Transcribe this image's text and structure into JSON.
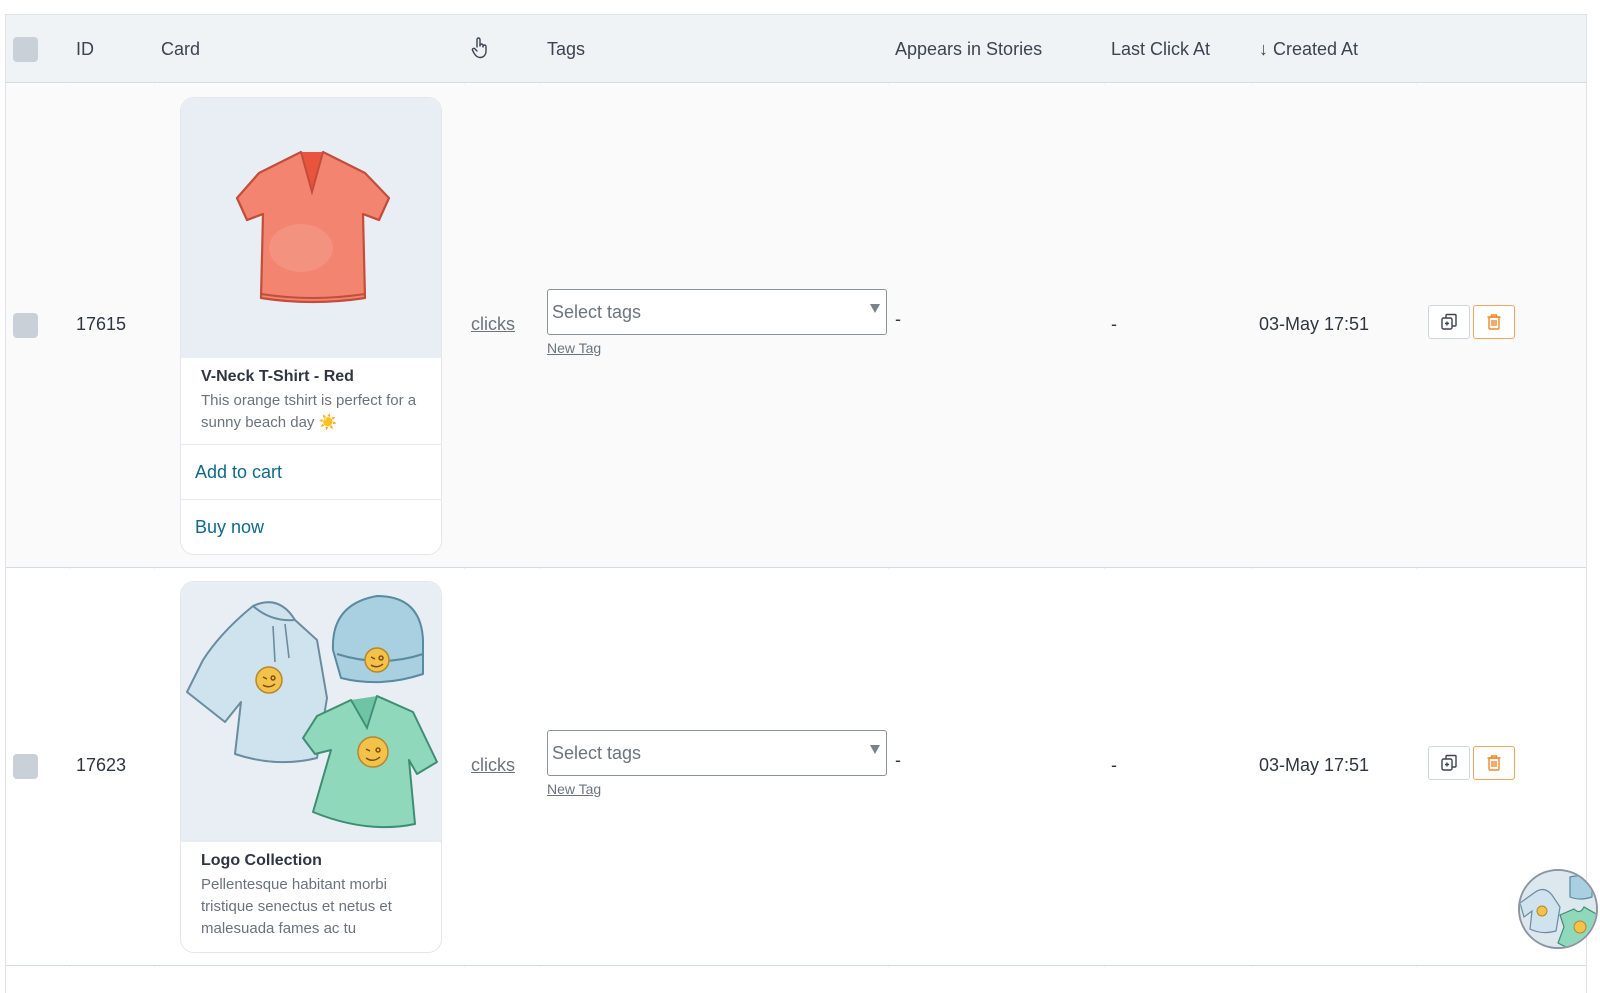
{
  "header": {
    "id": "ID",
    "card": "Card",
    "clicks_icon": "pointer-hand-icon",
    "tags": "Tags",
    "appears_in_stories": "Appears in Stories",
    "last_click_at": "Last Click At",
    "created_at": "↓ Created At"
  },
  "rows": [
    {
      "id": "17615",
      "card": {
        "title": "V-Neck T-Shirt - Red",
        "description": "This orange tshirt is perfect for a sunny beach day ☀️",
        "image": "red-tshirt-illustration",
        "buttons": [
          "Add to cart",
          "Buy now"
        ]
      },
      "clicks": "clicks",
      "tags_placeholder": "Select tags",
      "new_tag": "New Tag",
      "appears_in_stories": "-",
      "last_click_at": "-",
      "created_at": "03-May 17:51"
    },
    {
      "id": "17623",
      "card": {
        "title": "Logo Collection",
        "description": "Pellentesque habitant morbi tristique senectus et netus et malesuada fames ac tu",
        "image": "logo-collection-illustration"
      },
      "clicks": "clicks",
      "tags_placeholder": "Select tags",
      "new_tag": "New Tag",
      "appears_in_stories": "-",
      "last_click_at": "-",
      "created_at": "03-May 17:51"
    }
  ],
  "actions": {
    "duplicate_icon": "duplicate-icon",
    "delete_icon": "trash-icon"
  },
  "colors": {
    "header_bg": "#f0f3f6",
    "link_teal": "#0e6a8a",
    "delete_orange": "#f0a55a",
    "checkbox": "#c9d0d8"
  }
}
